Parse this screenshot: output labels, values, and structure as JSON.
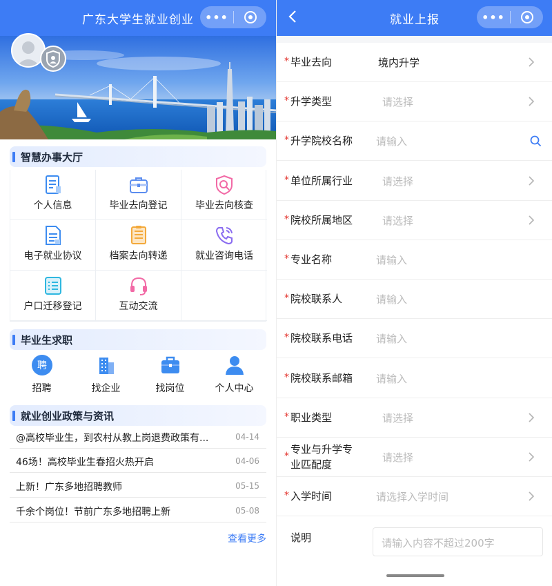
{
  "left_screen": {
    "title": "广东大学生就业创业",
    "capsule": {
      "menu_icon": "dots-icon",
      "close_icon": "target-icon"
    },
    "banner": {
      "avatar_icon": "user-avatar-icon",
      "badge_icon": "shield-user-icon"
    },
    "service_hall": {
      "heading": "智慧办事大厅",
      "items": [
        {
          "label": "个人信息",
          "icon": "document-icon",
          "color": "#3d8cf0"
        },
        {
          "label": "毕业去向登记",
          "icon": "briefcase-icon",
          "color": "#5b8def"
        },
        {
          "label": "毕业去向核查",
          "icon": "shield-search-icon",
          "color": "#f26aa6"
        },
        {
          "label": "电子就业协议",
          "icon": "contract-icon",
          "color": "#3d8cf0"
        },
        {
          "label": "档案去向转递",
          "icon": "archive-icon",
          "color": "#f3a93b"
        },
        {
          "label": "就业咨询电话",
          "icon": "phone-icon",
          "color": "#8a6cf0"
        },
        {
          "label": "户口迁移登记",
          "icon": "list-icon",
          "color": "#2fb7e0"
        },
        {
          "label": "互动交流",
          "icon": "headset-icon",
          "color": "#f26aa6"
        }
      ]
    },
    "job_seeking": {
      "heading": "毕业生求职",
      "items": [
        {
          "label": "招聘",
          "icon": "recruit-icon",
          "badge_char": "聘"
        },
        {
          "label": "找企业",
          "icon": "building-icon"
        },
        {
          "label": "找岗位",
          "icon": "job-briefcase-icon"
        },
        {
          "label": "个人中心",
          "icon": "person-icon"
        }
      ]
    },
    "news": {
      "heading": "就业创业政策与资讯",
      "items": [
        {
          "title": "@高校毕业生，到农村从教上岗退费政策有...",
          "date": "04-14"
        },
        {
          "title": "46场！高校毕业生春招火热开启",
          "date": "04-06"
        },
        {
          "title": "上新！广东多地招聘教师",
          "date": "05-15"
        },
        {
          "title": "千余个岗位！节前广东多地招聘上新",
          "date": "05-08"
        }
      ],
      "more": "查看更多"
    }
  },
  "right_screen": {
    "title": "就业上报",
    "back_icon": "chevron-left-icon",
    "fields": [
      {
        "label": "毕业去向",
        "value": "境内升学",
        "required": true,
        "kind": "select",
        "filled": true
      },
      {
        "label": "升学类型",
        "value": "请选择",
        "required": true,
        "kind": "select",
        "filled": false
      },
      {
        "label": "升学院校名称",
        "value": "请输入",
        "required": true,
        "kind": "search",
        "filled": false
      },
      {
        "label": "单位所属行业",
        "value": "请选择",
        "required": true,
        "kind": "select",
        "filled": false
      },
      {
        "label": "院校所属地区",
        "value": "请选择",
        "required": true,
        "kind": "select",
        "filled": false
      },
      {
        "label": "专业名称",
        "value": "请输入",
        "required": true,
        "kind": "input",
        "filled": false
      },
      {
        "label": "院校联系人",
        "value": "请输入",
        "required": true,
        "kind": "input",
        "filled": false
      },
      {
        "label": "院校联系电话",
        "value": "请输入",
        "required": true,
        "kind": "input",
        "filled": false
      },
      {
        "label": "院校联系邮箱",
        "value": "请输入",
        "required": true,
        "kind": "input",
        "filled": false
      },
      {
        "label": "职业类型",
        "value": "请选择",
        "required": true,
        "kind": "select",
        "filled": false
      },
      {
        "label": "专业与升学专业匹配度",
        "label_lines": [
          "专业与升学专",
          "业匹配度"
        ],
        "value": "请选择",
        "required": true,
        "kind": "select",
        "filled": false
      },
      {
        "label": "入学时间",
        "value": "请选择入学时间",
        "required": true,
        "kind": "select",
        "filled": false
      }
    ],
    "note": {
      "label": "说明",
      "placeholder": "请输入内容不超过200字"
    },
    "required_mark": "*"
  },
  "colors": {
    "brand": "#3d7cf5",
    "required": "#e3352f",
    "placeholder": "#bbbbbb"
  }
}
